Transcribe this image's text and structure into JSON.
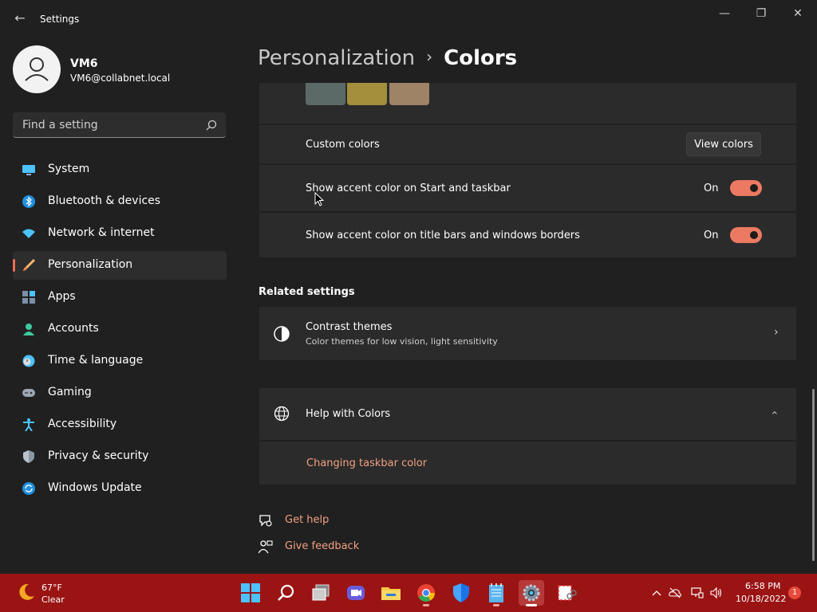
{
  "window": {
    "title": "Settings"
  },
  "user": {
    "name": "VM6",
    "email": "VM6@collabnet.local"
  },
  "search": {
    "placeholder": "Find a setting"
  },
  "sidebar": {
    "items": [
      {
        "label": "System",
        "icon": "monitor-icon"
      },
      {
        "label": "Bluetooth & devices",
        "icon": "bluetooth-icon"
      },
      {
        "label": "Network & internet",
        "icon": "wifi-icon"
      },
      {
        "label": "Personalization",
        "icon": "brush-icon",
        "active": true
      },
      {
        "label": "Apps",
        "icon": "apps-icon"
      },
      {
        "label": "Accounts",
        "icon": "person-icon"
      },
      {
        "label": "Time & language",
        "icon": "clock-globe-icon"
      },
      {
        "label": "Gaming",
        "icon": "gamepad-icon"
      },
      {
        "label": "Accessibility",
        "icon": "accessibility-icon"
      },
      {
        "label": "Privacy & security",
        "icon": "shield-icon"
      },
      {
        "label": "Windows Update",
        "icon": "update-icon"
      }
    ]
  },
  "breadcrumb": {
    "parent": "Personalization",
    "separator": "›",
    "current": "Colors"
  },
  "colors": {
    "swatches": [
      "#5b6a66",
      "#a38f3c",
      "#9e8366"
    ],
    "custom_colors_label": "Custom colors",
    "view_colors_button": "View colors",
    "accent_start_label": "Show accent color on Start and taskbar",
    "accent_start_state": "On",
    "accent_title_label": "Show accent color on title bars and windows borders",
    "accent_title_state": "On"
  },
  "related": {
    "title": "Related settings",
    "contrast_title": "Contrast themes",
    "contrast_sub": "Color themes for low vision, light sensitivity"
  },
  "help": {
    "title": "Help with Colors",
    "link": "Changing taskbar color",
    "get_help": "Get help",
    "give_feedback": "Give feedback"
  },
  "taskbar": {
    "temp": "67°F",
    "condition": "Clear",
    "time": "6:58 PM",
    "date": "10/18/2022",
    "notifications": "1"
  },
  "theme": {
    "accent": "#ec7a62",
    "link": "#f0a080",
    "taskbar": "#9a1414",
    "background": "#202020",
    "card": "#2b2b2b"
  }
}
